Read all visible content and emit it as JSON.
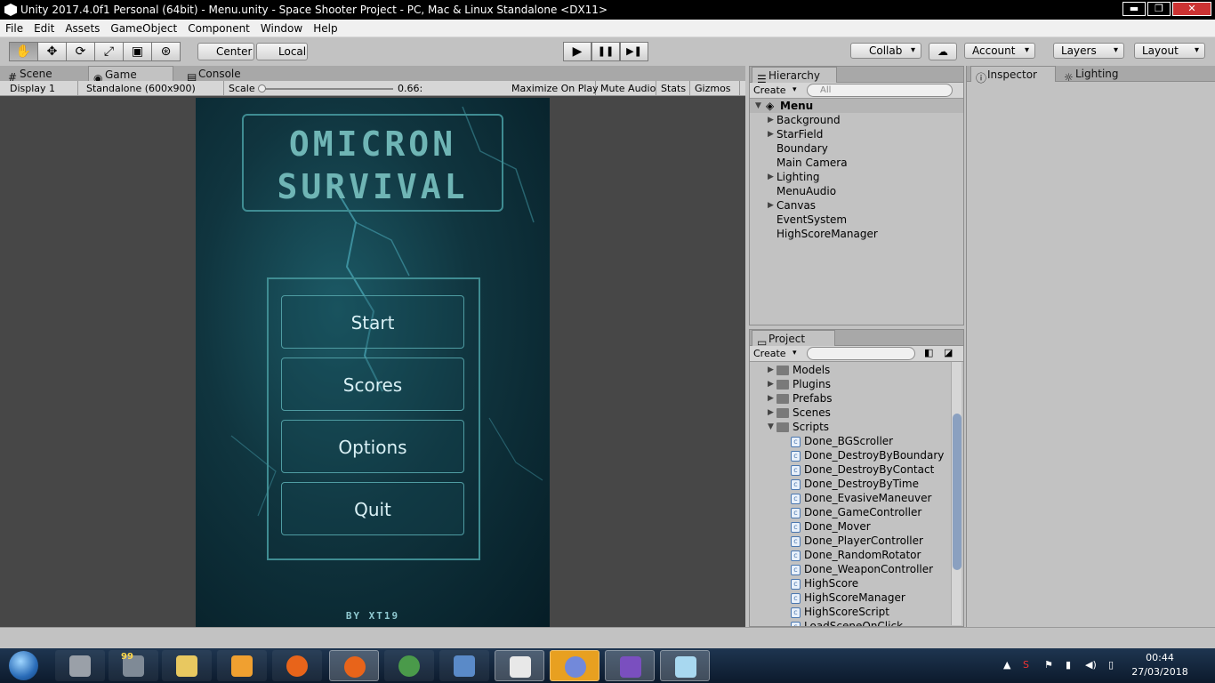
{
  "window": {
    "title": "Unity 2017.4.0f1 Personal (64bit) - Menu.unity - Space Shooter Project - PC, Mac & Linux Standalone <DX11>",
    "minimize": "▬",
    "maximize": "❐",
    "close": "✕"
  },
  "menubar": [
    "File",
    "Edit",
    "Assets",
    "GameObject",
    "Component",
    "Window",
    "Help"
  ],
  "toolbar": {
    "pivot_label": "Center",
    "space_label": "Local",
    "collab_label": "Collab",
    "account_label": "Account",
    "layers_label": "Layers",
    "layout_label": "Layout",
    "play_icon": "▶",
    "pause_icon": "❚❚",
    "step_icon": "▶❚"
  },
  "left_tabs": {
    "scene": "Scene",
    "game": "Game",
    "console": "Console"
  },
  "game_toolbar": {
    "display": "Display 1",
    "resolution": "Standalone (600x900)",
    "scale_label": "Scale",
    "scale_value": "0.66:",
    "scale_fraction": 0.0,
    "maximize": "Maximize On Play",
    "mute": "Mute Audio",
    "stats": "Stats",
    "gizmos": "Gizmos"
  },
  "game": {
    "title_line1": "OMICRON",
    "title_line2": "SURVIVAL",
    "buttons": [
      "Start",
      "Scores",
      "Options",
      "Quit"
    ],
    "credit": "BY XT19"
  },
  "hierarchy": {
    "tab": "Hierarchy",
    "create": "Create",
    "search_placeholder": "All",
    "scene_name": "Menu",
    "items": [
      {
        "label": "Background",
        "expandable": true
      },
      {
        "label": "StarField",
        "expandable": true
      },
      {
        "label": "Boundary",
        "expandable": false
      },
      {
        "label": "Main Camera",
        "expandable": false
      },
      {
        "label": "Lighting",
        "expandable": true
      },
      {
        "label": "MenuAudio",
        "expandable": false
      },
      {
        "label": "Canvas",
        "expandable": true
      },
      {
        "label": "EventSystem",
        "expandable": false
      },
      {
        "label": "HighScoreManager",
        "expandable": false
      }
    ]
  },
  "project": {
    "tab": "Project",
    "create": "Create",
    "folders": [
      "Models",
      "Plugins",
      "Prefabs",
      "Scenes",
      "Scripts"
    ],
    "scripts": [
      "Done_BGScroller",
      "Done_DestroyByBoundary",
      "Done_DestroyByContact",
      "Done_DestroyByTime",
      "Done_EvasiveManeuver",
      "Done_GameController",
      "Done_Mover",
      "Done_PlayerController",
      "Done_RandomRotator",
      "Done_WeaponController",
      "HighScore",
      "HighScoreManager",
      "HighScoreScript",
      "LoadSceneOnClick"
    ]
  },
  "inspector": {
    "tab": "Inspector",
    "lighting_tab": "Lighting"
  },
  "taskbar": {
    "time": "00:44",
    "date": "27/03/2018",
    "badge": "99"
  },
  "colors": {
    "editor_bg": "#c2c2c2",
    "game_accent": "#3f8c92",
    "taskbar": "#1e3550"
  }
}
